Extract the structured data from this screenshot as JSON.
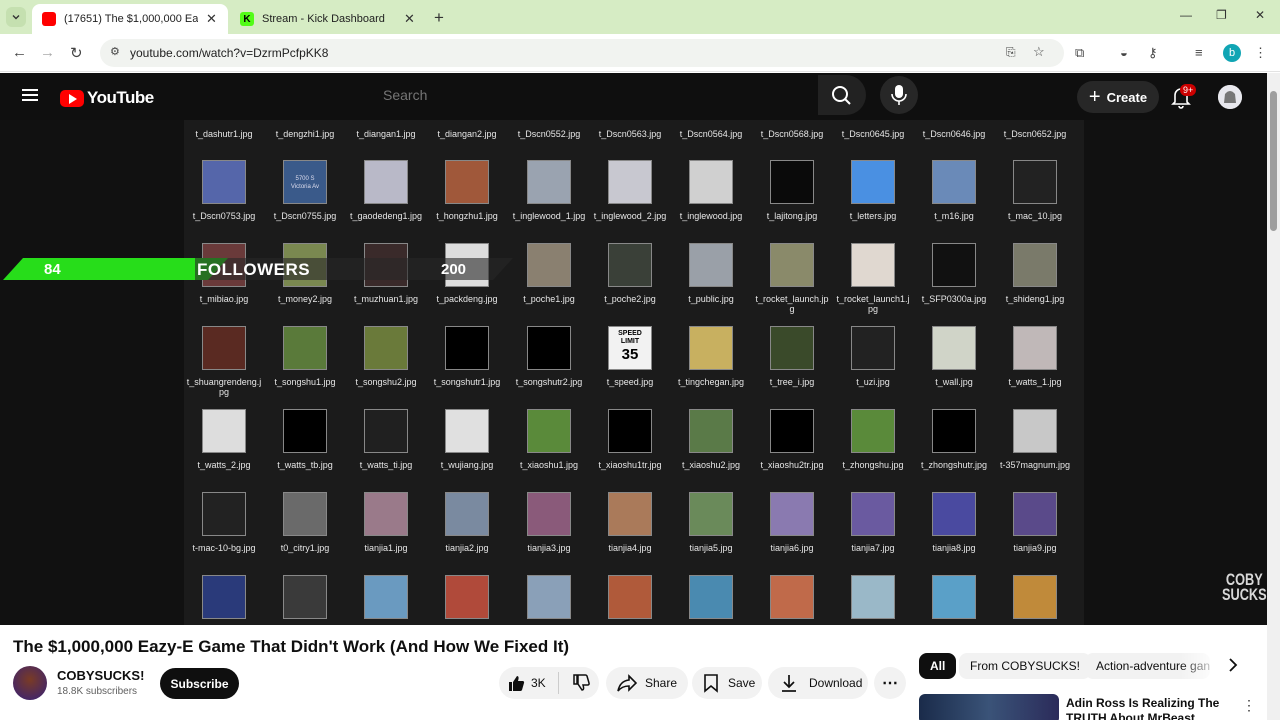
{
  "browser": {
    "tabs": [
      {
        "title": "(17651) The $1,000,000 Eazy-E",
        "active": true,
        "icon": "youtube-favicon"
      },
      {
        "title": "Stream - Kick Dashboard",
        "active": false,
        "icon": "kick-favicon"
      }
    ],
    "new_tab": "+",
    "close": "✕",
    "url": "youtube.com/watch?v=DzrmPcfpKK8",
    "profile_letter": "b"
  },
  "youtube": {
    "logo_text": "YouTube",
    "search_placeholder": "Search",
    "create_label": "Create",
    "notif_count": "9+"
  },
  "explorer": {
    "top_row": [
      "t_dashutr1.jpg",
      "t_dengzhi1.jpg",
      "t_diangan1.jpg",
      "t_diangan2.jpg",
      "t_Dscn0552.jpg",
      "t_Dscn0563.jpg",
      "t_Dscn0564.jpg",
      "t_Dscn0568.jpg",
      "t_Dscn0645.jpg",
      "t_Dscn0646.jpg",
      "t_Dscn0652.jpg"
    ],
    "rows": [
      [
        "t_Dscn0753.jpg",
        "t_Dscn0755.jpg",
        "t_gaodedeng1.jpg",
        "t_hongzhu1.jpg",
        "t_inglewood_1.jpg",
        "t_inglewood_2.jpg",
        "t_inglewood.jpg",
        "t_lajitong.jpg",
        "t_letters.jpg",
        "t_m16.jpg",
        "t_mac_10.jpg"
      ],
      [
        "t_mibiao.jpg",
        "t_money2.jpg",
        "t_muzhuan1.jpg",
        "t_packdeng.jpg",
        "t_poche1.jpg",
        "t_poche2.jpg",
        "t_public.jpg",
        "t_rocket_launch.jpg",
        "t_rocket_launch1.jpg",
        "t_SFP0300a.jpg",
        "t_shideng1.jpg"
      ],
      [
        "t_shuangrendeng.jpg",
        "t_songshu1.jpg",
        "t_songshu2.jpg",
        "t_songshutr1.jpg",
        "t_songshutr2.jpg",
        "t_speed.jpg",
        "t_tingchegan.jpg",
        "t_tree_i.jpg",
        "t_uzi.jpg",
        "t_wall.jpg",
        "t_watts_1.jpg"
      ],
      [
        "t_watts_2.jpg",
        "t_watts_tb.jpg",
        "t_watts_ti.jpg",
        "t_wujiang.jpg",
        "t_xiaoshu1.jpg",
        "t_xiaoshu1tr.jpg",
        "t_xiaoshu2.jpg",
        "t_xiaoshu2tr.jpg",
        "t_zhongshu.jpg",
        "t_zhongshutr.jpg",
        "t-357magnum.jpg"
      ],
      [
        "t-mac-10-bg.jpg",
        "t0_citry1.jpg",
        "tianjia1.jpg",
        "tianjia2.jpg",
        "tianjia3.jpg",
        "tianjia4.jpg",
        "tianjia5.jpg",
        "tianjia6.jpg",
        "tianjia7.jpg",
        "tianjia8.jpg",
        "tianjia9.jpg"
      ],
      [
        "",
        "",
        "",
        "",
        "",
        "",
        "",
        "",
        "",
        "",
        ""
      ]
    ],
    "speed_sign": [
      "SPEED",
      "LIMIT",
      "35"
    ],
    "street_sign": [
      "5700 S",
      "Victoria Av"
    ]
  },
  "overlay": {
    "count_left": "84",
    "label": "FOLLOWERS",
    "count_right": "200"
  },
  "watermark": [
    "COBY",
    "SUCKS"
  ],
  "video": {
    "title": "The $1,000,000 Eazy-E Game That Didn't Work (And How We Fixed It)",
    "channel": "COBYSUCKS!",
    "subscribers": "18.8K subscribers",
    "subscribe": "Subscribe",
    "likes": "3K",
    "share": "Share",
    "save": "Save",
    "download": "Download"
  },
  "chips": [
    "All",
    "From COBYSUCKS!",
    "Action-adventure gan"
  ],
  "recommendation": {
    "title": "Adin Ross Is Realizing The TRUTH About MrBeast"
  },
  "colors": {
    "youtube_red": "#ff0000",
    "overlay_green": "#27dd1a",
    "tab_strip": "#d6ecc4"
  }
}
